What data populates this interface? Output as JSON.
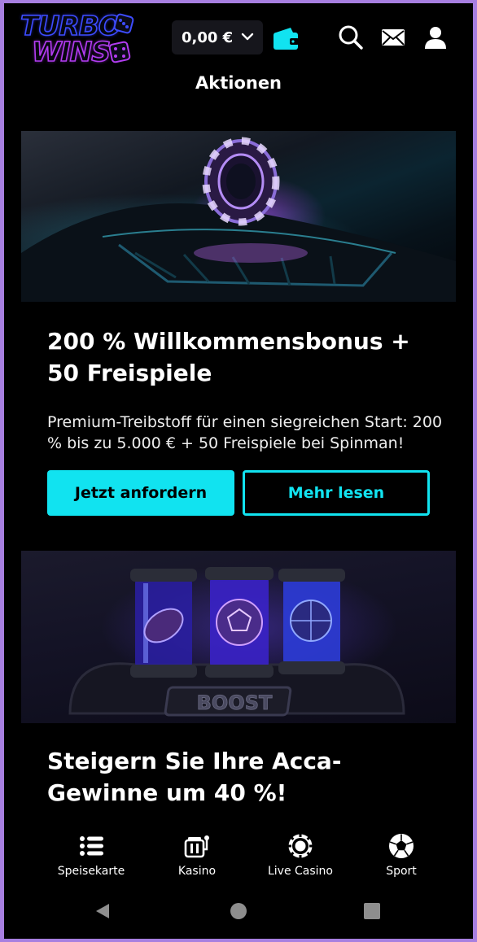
{
  "header": {
    "logo_line1": "TURBO",
    "logo_line2": "WINS",
    "balance": "0,00 €",
    "icons": [
      "chevron-down-icon",
      "wallet-icon",
      "search-icon",
      "mail-icon",
      "user-icon"
    ]
  },
  "page": {
    "title": "Aktionen"
  },
  "promos": [
    {
      "title": "200 % Willkommensbonus + 50 Freispiele",
      "description": "Premium-Treibstoff für einen siegreichen Start: 200 % bis zu 5.000 € + 50 Freispiele bei Spinman!",
      "primary_label": "Jetzt anfordern",
      "secondary_label": "Mehr lesen"
    },
    {
      "title": "Steigern Sie Ihre Acca-Gewinne um 40 %!",
      "banner_text": "BOOST"
    }
  ],
  "bottom_nav": [
    {
      "label": "Speisekarte",
      "icon": "menu-list-icon"
    },
    {
      "label": "Kasino",
      "icon": "slot-machine-icon"
    },
    {
      "label": "Live Casino",
      "icon": "casino-chip-icon"
    },
    {
      "label": "Sport",
      "icon": "soccer-ball-icon"
    }
  ],
  "colors": {
    "accent": "#11e3f0",
    "background": "#000000",
    "frame": "#a77fe0"
  }
}
